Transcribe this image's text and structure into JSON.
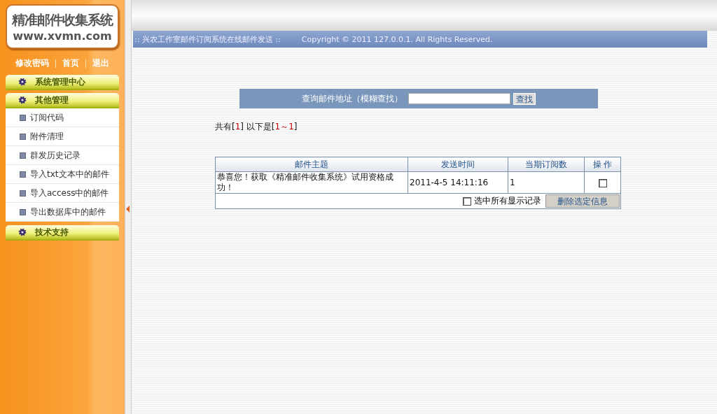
{
  "logo": {
    "title": "精准邮件收集系统",
    "url": "www.xvmn.com"
  },
  "top_links": [
    "修改密码",
    "首页",
    "退出"
  ],
  "sidebar": {
    "sections": [
      {
        "label": "系统管理中心"
      },
      {
        "label": "其他管理",
        "children": [
          {
            "label": "订阅代码"
          },
          {
            "label": "附件清理"
          },
          {
            "label": "群发历史记录"
          },
          {
            "label": "导入txt文本中的邮件"
          },
          {
            "label": "导入access中的邮件"
          },
          {
            "label": "导出数据库中的邮件"
          }
        ]
      },
      {
        "label": "技术支持"
      }
    ]
  },
  "header_bar": {
    "title": ":: 兴农工作室邮件订阅系统在线邮件发送 ::",
    "copyright": "Copyright © 2011 127.0.0.1. All Rights Reserved."
  },
  "search": {
    "label": "查询邮件地址（模糊查找）",
    "button": "查找"
  },
  "summary": [
    {
      "text": "共有[",
      "kind": "plain"
    },
    {
      "text": "1",
      "kind": "number"
    },
    {
      "text": "] 以下是[",
      "kind": "plain"
    },
    {
      "text": "1～1",
      "kind": "number"
    },
    {
      "text": "]",
      "kind": "plain"
    }
  ],
  "table": {
    "columns": [
      "邮件主题",
      "发送时间",
      "当期订阅数",
      "操 作"
    ],
    "rows": [
      {
        "subject": "恭喜您！获取《精准邮件收集系统》试用资格成功！",
        "time": "2011-4-5 14:11:16",
        "count": "1",
        "checked": false
      }
    ],
    "select_all": {
      "label": "选中所有显示记录",
      "checked": false
    },
    "delete_button": "删除选定信息"
  }
}
